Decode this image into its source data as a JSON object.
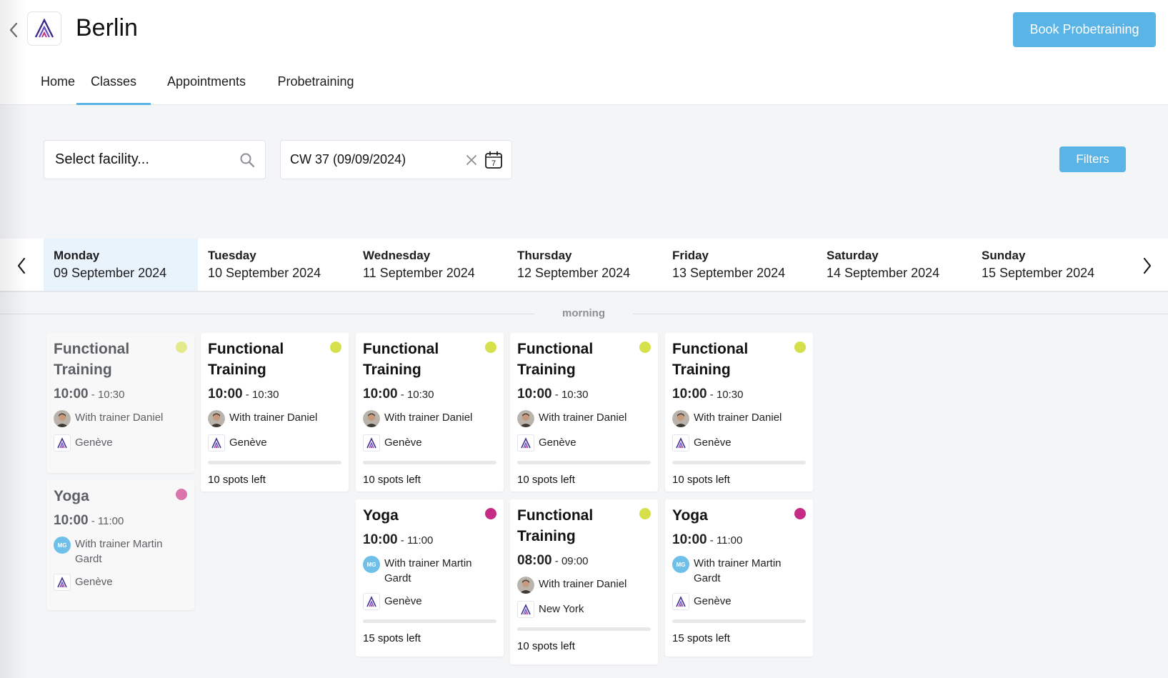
{
  "header": {
    "title": "Berlin",
    "book_label": "Book Probetraining"
  },
  "tabs": [
    {
      "label": "Home"
    },
    {
      "label": "Classes"
    },
    {
      "label": "Appointments"
    },
    {
      "label": "Probetraining"
    }
  ],
  "active_tab": "Classes",
  "filters": {
    "facility_placeholder": "Select facility...",
    "week_value": "CW 37 (09/09/2024)",
    "calendar_day": "7",
    "filters_label": "Filters"
  },
  "days": [
    {
      "name": "Monday",
      "date": "09 September 2024"
    },
    {
      "name": "Tuesday",
      "date": "10 September 2024"
    },
    {
      "name": "Wednesday",
      "date": "11 September 2024"
    },
    {
      "name": "Thursday",
      "date": "12 September 2024"
    },
    {
      "name": "Friday",
      "date": "13 September 2024"
    },
    {
      "name": "Saturday",
      "date": "14 September 2024"
    },
    {
      "name": "Sunday",
      "date": "15 September 2024"
    }
  ],
  "section_label": "morning",
  "colors": {
    "accent": "#5ab4e5",
    "functional_dot": "#d6e04a",
    "yoga_dot": "#c62a87",
    "functional_dot_past": "#e4ea8c",
    "yoga_dot_past": "#d974ad"
  },
  "cards": {
    "mon_ft": {
      "name": "Functional Training",
      "start": "10:00",
      "end": " - 10:30",
      "trainer": "With trainer Daniel",
      "location": "Genève"
    },
    "mon_yoga": {
      "name": "Yoga",
      "start": "10:00",
      "end": " - 11:00",
      "trainer": "With trainer Martin Gardt",
      "initials": "MG",
      "location": "Genève"
    },
    "tue_ft": {
      "name": "Functional Training",
      "start": "10:00",
      "end": " - 10:30",
      "trainer": "With trainer Daniel",
      "location": "Genève",
      "spots": "10 spots left"
    },
    "wed_ft": {
      "name": "Functional Training",
      "start": "10:00",
      "end": " - 10:30",
      "trainer": "With trainer Daniel",
      "location": "Genève",
      "spots": "10 spots left"
    },
    "wed_yoga": {
      "name": "Yoga",
      "start": "10:00",
      "end": " - 11:00",
      "trainer": "With trainer Martin Gardt",
      "initials": "MG",
      "location": "Genève",
      "spots": "15 spots left"
    },
    "thu_ft": {
      "name": "Functional Training",
      "start": "10:00",
      "end": " - 10:30",
      "trainer": "With trainer Daniel",
      "location": "Genève",
      "spots": "10 spots left"
    },
    "thu_ft2": {
      "name": "Functional Training",
      "start": "08:00",
      "end": " - 09:00",
      "trainer": "With trainer Daniel",
      "location": "New York",
      "spots": "10 spots left"
    },
    "fri_ft": {
      "name": "Functional Training",
      "start": "10:00",
      "end": " - 10:30",
      "trainer": "With trainer Daniel",
      "location": "Genève",
      "spots": "10 spots left"
    },
    "fri_yoga": {
      "name": "Yoga",
      "start": "10:00",
      "end": " - 11:00",
      "trainer": "With trainer Martin Gardt",
      "initials": "MG",
      "location": "Genève",
      "spots": "15 spots left"
    }
  }
}
